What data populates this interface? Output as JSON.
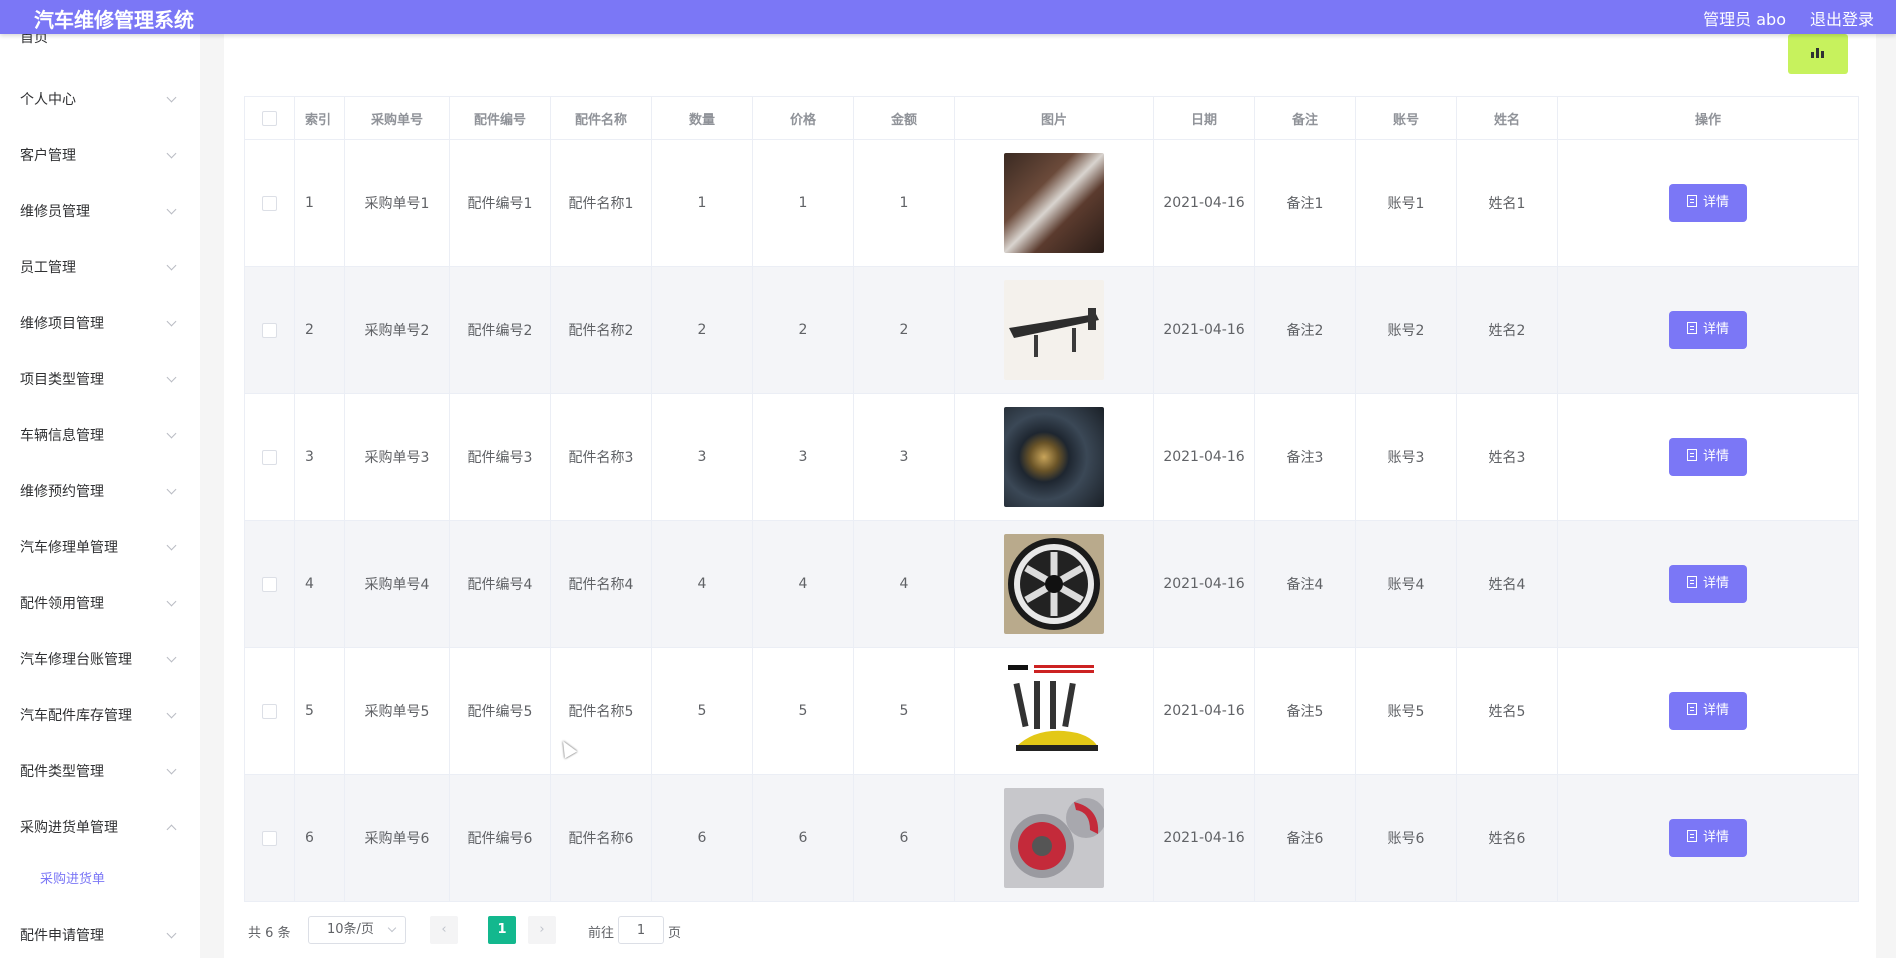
{
  "header": {
    "title": "汽车维修管理系统",
    "user": "管理员 abo",
    "logout": "退出登录"
  },
  "sidebar": {
    "items": [
      {
        "label": "首页"
      },
      {
        "label": "个人中心"
      },
      {
        "label": "客户管理"
      },
      {
        "label": "维修员管理"
      },
      {
        "label": "员工管理"
      },
      {
        "label": "维修项目管理"
      },
      {
        "label": "项目类型管理"
      },
      {
        "label": "车辆信息管理"
      },
      {
        "label": "维修预约管理"
      },
      {
        "label": "汽车修理单管理"
      },
      {
        "label": "配件领用管理"
      },
      {
        "label": "汽车修理台账管理"
      },
      {
        "label": "汽车配件库存管理"
      },
      {
        "label": "配件类型管理"
      },
      {
        "label": "采购进货单管理"
      },
      {
        "label": "配件申请管理"
      }
    ],
    "submenu": {
      "label": "采购进货单"
    }
  },
  "table": {
    "headers": {
      "index": "索引",
      "order_no": "采购单号",
      "part_no": "配件编号",
      "part_name": "配件名称",
      "qty": "数量",
      "price": "价格",
      "amount": "金额",
      "image": "图片",
      "date": "日期",
      "note": "备注",
      "account": "账号",
      "name": "姓名",
      "action": "操作"
    },
    "rows": [
      {
        "index": "1",
        "order_no": "采购单号1",
        "part_no": "配件编号1",
        "part_name": "配件名称1",
        "qty": "1",
        "price": "1",
        "amount": "1",
        "image": "car-seat-cushion-image",
        "date": "2021-04-16",
        "note": "备注1",
        "account": "账号1",
        "name": "姓名1",
        "action": "详情"
      },
      {
        "index": "2",
        "order_no": "采购单号2",
        "part_no": "配件编号2",
        "part_name": "配件名称2",
        "qty": "2",
        "price": "2",
        "amount": "2",
        "image": "car-spoiler-image",
        "date": "2021-04-16",
        "note": "备注2",
        "account": "账号2",
        "name": "姓名2",
        "action": "详情"
      },
      {
        "index": "3",
        "order_no": "采购单号3",
        "part_no": "配件编号3",
        "part_name": "配件名称3",
        "qty": "3",
        "price": "3",
        "amount": "3",
        "image": "car-headlight-image",
        "date": "2021-04-16",
        "note": "备注3",
        "account": "账号3",
        "name": "姓名3",
        "action": "详情"
      },
      {
        "index": "4",
        "order_no": "采购单号4",
        "part_no": "配件编号4",
        "part_name": "配件名称4",
        "qty": "4",
        "price": "4",
        "amount": "4",
        "image": "car-wheel-rim-image",
        "date": "2021-04-16",
        "note": "备注4",
        "account": "账号4",
        "name": "姓名4",
        "action": "详情"
      },
      {
        "index": "5",
        "order_no": "采购单号5",
        "part_no": "配件编号5",
        "part_name": "配件名称5",
        "qty": "5",
        "price": "5",
        "amount": "5",
        "image": "suspension-coilover-image",
        "date": "2021-04-16",
        "note": "备注5",
        "account": "账号5",
        "name": "姓名5",
        "action": "详情"
      },
      {
        "index": "6",
        "order_no": "采购单号6",
        "part_no": "配件编号6",
        "part_name": "配件名称6",
        "qty": "6",
        "price": "6",
        "amount": "6",
        "image": "brake-caliper-image",
        "date": "2021-04-16",
        "note": "备注6",
        "account": "账号6",
        "name": "姓名6",
        "action": "详情"
      }
    ]
  },
  "pagination": {
    "total": "共 6 条",
    "page_size": "10条/页",
    "current_page": "1",
    "goto_label": "前往",
    "goto_value": "1",
    "page_unit": "页"
  },
  "colors": {
    "primary": "#7b77f6",
    "chart_button": "#c7f25d",
    "current_page": "#13b88e"
  }
}
